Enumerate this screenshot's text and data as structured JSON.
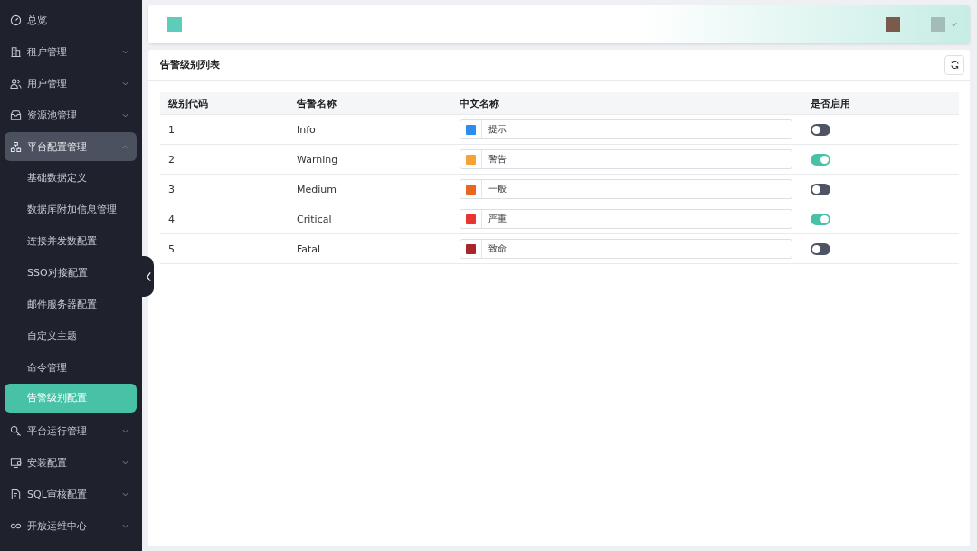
{
  "sidebar": {
    "items": [
      {
        "label": "总览",
        "selected": false
      },
      {
        "label": "租户管理",
        "expanded": false,
        "selected": false
      },
      {
        "label": "用户管理",
        "expanded": false,
        "selected": false
      },
      {
        "label": "资源池管理",
        "expanded": false,
        "selected": false
      },
      {
        "label": "平台配置管理",
        "expanded": true,
        "selected": false,
        "children": [
          {
            "label": "基础数据定义",
            "selected": false
          },
          {
            "label": "数据库附加信息管理",
            "selected": false
          },
          {
            "label": "连接并发数配置",
            "selected": false
          },
          {
            "label": "SSO对接配置",
            "selected": false
          },
          {
            "label": "邮件服务器配置",
            "selected": false
          },
          {
            "label": "自定义主题",
            "selected": false
          },
          {
            "label": "命令管理",
            "selected": false
          },
          {
            "label": "告警级别配置",
            "selected": true
          }
        ]
      },
      {
        "label": "平台运行管理",
        "expanded": false,
        "selected": false
      },
      {
        "label": "安装配置",
        "expanded": false,
        "selected": false
      },
      {
        "label": "SQL审核配置",
        "expanded": false,
        "selected": false
      },
      {
        "label": "开放运维中心",
        "expanded": false,
        "selected": false
      }
    ]
  },
  "panel": {
    "title": "告警级别列表",
    "table": {
      "columns": [
        "级别代码",
        "告警名称",
        "中文名称",
        "是否启用"
      ],
      "rows": [
        {
          "code": "1",
          "name": "Info",
          "cn_name": "提示",
          "color": "#2d8cf0",
          "enabled": false
        },
        {
          "code": "2",
          "name": "Warning",
          "cn_name": "警告",
          "color": "#f7a234",
          "enabled": true
        },
        {
          "code": "3",
          "name": "Medium",
          "cn_name": "一般",
          "color": "#e8661f",
          "enabled": false
        },
        {
          "code": "4",
          "name": "Critical",
          "cn_name": "严重",
          "color": "#e8352f",
          "enabled": true
        },
        {
          "code": "5",
          "name": "Fatal",
          "cn_name": "致命",
          "color": "#a8262a",
          "enabled": false
        }
      ]
    }
  }
}
